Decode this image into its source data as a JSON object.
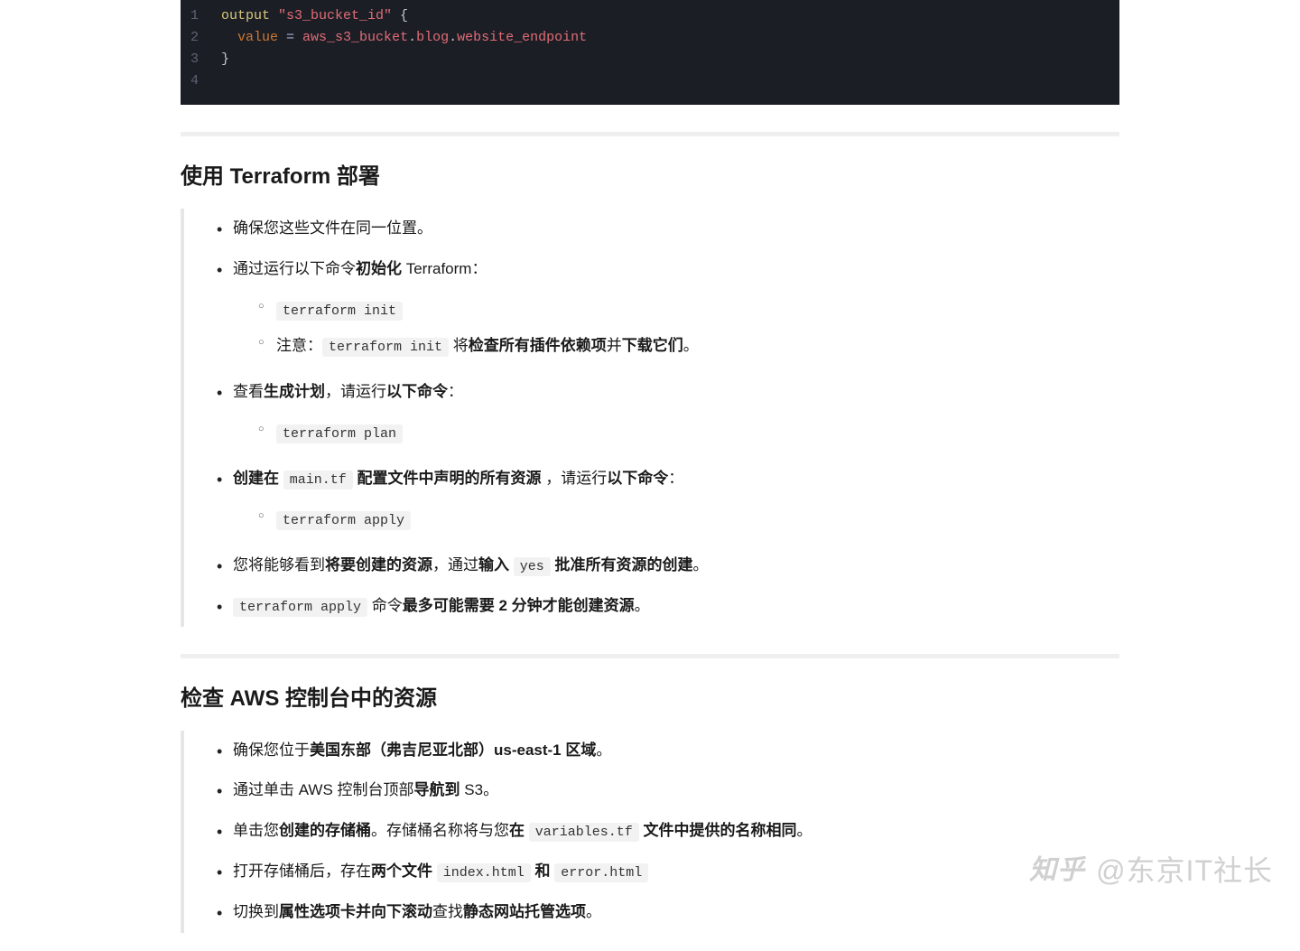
{
  "code": {
    "lines": [
      {
        "num": "1",
        "tokens": [
          {
            "cls": "tok-kw",
            "t": "output "
          },
          {
            "cls": "tok-str",
            "t": "\"s3_bucket_id\""
          },
          {
            "cls": "tok-punct",
            "t": " {"
          }
        ]
      },
      {
        "num": "2",
        "tokens": [
          {
            "cls": "tok-punct",
            "t": "  "
          },
          {
            "cls": "tok-ident",
            "t": "value"
          },
          {
            "cls": "tok-op",
            "t": " = "
          },
          {
            "cls": "tok-prop",
            "t": "aws_s3_bucket"
          },
          {
            "cls": "tok-punct",
            "t": "."
          },
          {
            "cls": "tok-prop",
            "t": "blog"
          },
          {
            "cls": "tok-punct",
            "t": "."
          },
          {
            "cls": "tok-prop",
            "t": "website_endpoint"
          }
        ]
      },
      {
        "num": "3",
        "tokens": [
          {
            "cls": "tok-punct",
            "t": "}"
          }
        ]
      },
      {
        "num": "4",
        "tokens": []
      }
    ]
  },
  "section1": {
    "heading": "使用 Terraform 部署",
    "items": [
      {
        "parts": [
          {
            "b": false,
            "t": "确保您这些文件在同一位置。"
          }
        ]
      },
      {
        "parts": [
          {
            "b": false,
            "t": "通过运行以下命令"
          },
          {
            "b": true,
            "t": "初始化"
          },
          {
            "b": false,
            "t": " Terraform："
          }
        ],
        "sub": [
          {
            "parts": [
              {
                "code": true,
                "t": "terraform init"
              }
            ]
          },
          {
            "parts": [
              {
                "b": false,
                "t": "注意："
              },
              {
                "code": true,
                "t": "terraform init"
              },
              {
                "b": false,
                "t": " 将"
              },
              {
                "b": true,
                "t": "检查所有插件依赖项"
              },
              {
                "b": false,
                "t": "并"
              },
              {
                "b": true,
                "t": "下载它们"
              },
              {
                "b": false,
                "t": "。"
              }
            ]
          }
        ]
      },
      {
        "parts": [
          {
            "b": false,
            "t": "查看"
          },
          {
            "b": true,
            "t": "生成计划"
          },
          {
            "b": false,
            "t": "，请运行"
          },
          {
            "b": true,
            "t": "以下命令"
          },
          {
            "b": false,
            "t": "："
          }
        ],
        "sub": [
          {
            "parts": [
              {
                "code": true,
                "t": "terraform plan"
              }
            ]
          }
        ]
      },
      {
        "parts": [
          {
            "b": true,
            "t": "创建在 "
          },
          {
            "code": true,
            "t": "main.tf"
          },
          {
            "b": true,
            "t": " 配置文件中声明的所有资源"
          },
          {
            "b": false,
            "t": " ，请运行"
          },
          {
            "b": true,
            "t": "以下命令"
          },
          {
            "b": false,
            "t": "："
          }
        ],
        "sub": [
          {
            "parts": [
              {
                "code": true,
                "t": "terraform apply"
              }
            ]
          }
        ]
      },
      {
        "parts": [
          {
            "b": false,
            "t": "您将能够看到"
          },
          {
            "b": true,
            "t": "将要创建的资源"
          },
          {
            "b": false,
            "t": "，通过"
          },
          {
            "b": true,
            "t": "输入 "
          },
          {
            "code": true,
            "t": "yes"
          },
          {
            "b": true,
            "t": " 批准所有资源的创建"
          },
          {
            "b": false,
            "t": "。"
          }
        ]
      },
      {
        "parts": [
          {
            "code": true,
            "t": "terraform apply"
          },
          {
            "b": false,
            "t": " 命令"
          },
          {
            "b": true,
            "t": "最多可能需要 2 分钟才能创建资源"
          },
          {
            "b": false,
            "t": "。"
          }
        ]
      }
    ]
  },
  "section2": {
    "heading": "检查 AWS 控制台中的资源",
    "items": [
      {
        "parts": [
          {
            "b": false,
            "t": "确保您位于"
          },
          {
            "b": true,
            "t": "美国东部（弗吉尼亚北部）us-east-1 区域"
          },
          {
            "b": false,
            "t": "。"
          }
        ]
      },
      {
        "parts": [
          {
            "b": false,
            "t": "通过单击 AWS 控制台顶部"
          },
          {
            "b": true,
            "t": "导航到"
          },
          {
            "b": false,
            "t": " S3。"
          }
        ]
      },
      {
        "parts": [
          {
            "b": false,
            "t": "单击您"
          },
          {
            "b": true,
            "t": "创建的存储桶"
          },
          {
            "b": false,
            "t": "。存储桶名称将与您"
          },
          {
            "b": true,
            "t": "在 "
          },
          {
            "code": true,
            "t": "variables.tf"
          },
          {
            "b": true,
            "t": " 文件中提供的名称相同"
          },
          {
            "b": false,
            "t": "。"
          }
        ]
      },
      {
        "parts": [
          {
            "b": false,
            "t": "打开存储桶后，存在"
          },
          {
            "b": true,
            "t": "两个文件 "
          },
          {
            "code": true,
            "t": "index.html"
          },
          {
            "b": true,
            "t": " 和 "
          },
          {
            "code": true,
            "t": "error.html"
          }
        ]
      },
      {
        "parts": [
          {
            "b": false,
            "t": "切换到"
          },
          {
            "b": true,
            "t": "属性选项卡并向下滚动"
          },
          {
            "b": false,
            "t": "查找"
          },
          {
            "b": true,
            "t": "静态网站托管选项"
          },
          {
            "b": false,
            "t": "。"
          }
        ]
      }
    ]
  },
  "watermark": {
    "logo": "知乎",
    "text": "@东京IT社长"
  }
}
